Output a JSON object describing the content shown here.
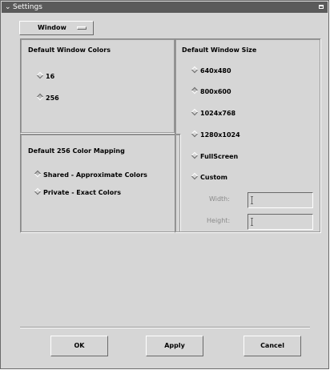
{
  "window": {
    "title": "Settings"
  },
  "tab_menu": {
    "selected": "Window"
  },
  "colors": {
    "title": "Default Window Colors",
    "options": [
      {
        "label": "16",
        "selected": false
      },
      {
        "label": "256",
        "selected": true
      }
    ]
  },
  "mapping": {
    "title": "Default 256 Color Mapping",
    "options": [
      {
        "label": "Shared - Approximate Colors",
        "selected": true
      },
      {
        "label": "Private - Exact Colors",
        "selected": false
      }
    ]
  },
  "size": {
    "title": "Default Window Size",
    "options": [
      {
        "label": "640x480",
        "selected": false
      },
      {
        "label": "800x600",
        "selected": true
      },
      {
        "label": "1024x768",
        "selected": false
      },
      {
        "label": "1280x1024",
        "selected": false
      },
      {
        "label": "FullScreen",
        "selected": false
      },
      {
        "label": "Custom",
        "selected": false
      }
    ],
    "width_label": "Width:",
    "width_value": "",
    "height_label": "Height:",
    "height_value": ""
  },
  "buttons": {
    "ok": "OK",
    "apply": "Apply",
    "cancel": "Cancel"
  }
}
